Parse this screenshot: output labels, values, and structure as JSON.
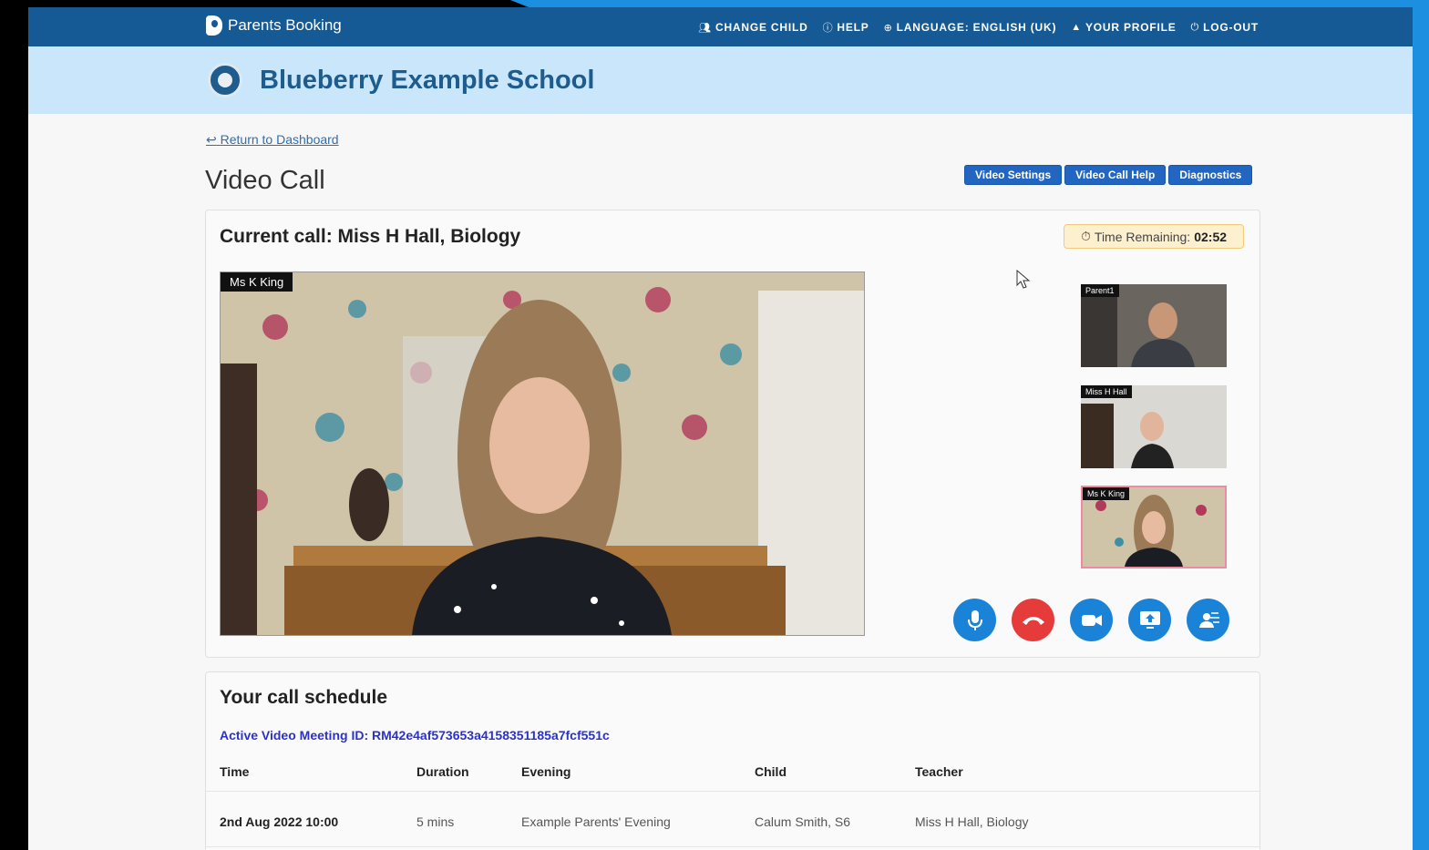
{
  "app": {
    "brand": "Parents Booking",
    "nav": [
      {
        "label": "CHANGE CHILD",
        "icon": "users-icon"
      },
      {
        "label": "HELP",
        "icon": "help-circle-icon"
      },
      {
        "label": "LANGUAGE: ENGLISH (UK)",
        "icon": "globe-icon"
      },
      {
        "label": "YOUR PROFILE",
        "icon": "user-icon"
      },
      {
        "label": "LOG-OUT",
        "icon": "power-icon"
      }
    ]
  },
  "school": {
    "name": "Blueberry Example School"
  },
  "page": {
    "return_link": "Return to Dashboard",
    "title": "Video Call",
    "buttons": {
      "video_settings": "Video Settings",
      "video_call_help": "Video Call Help",
      "diagnostics": "Diagnostics"
    }
  },
  "call": {
    "title": "Current call: Miss H Hall, Biology",
    "timer_label": "Time Remaining:",
    "timer_value": "02:52",
    "main_video_label": "Ms K King",
    "participants": [
      {
        "label": "Parent1"
      },
      {
        "label": "Miss H Hall"
      },
      {
        "label": "Ms K King"
      }
    ],
    "controls": [
      {
        "name": "microphone-button",
        "icon": "microphone-icon",
        "color": "#1a82d7"
      },
      {
        "name": "hang-up-button",
        "icon": "phone-hangup-icon",
        "color": "#e53b3b"
      },
      {
        "name": "camera-button",
        "icon": "video-camera-icon",
        "color": "#1a82d7"
      },
      {
        "name": "share-screen-button",
        "icon": "screen-share-icon",
        "color": "#1a82d7"
      },
      {
        "name": "background-blur-button",
        "icon": "background-blur-icon",
        "color": "#1a82d7"
      }
    ]
  },
  "schedule": {
    "title": "Your call schedule",
    "meeting_id": "Active Video Meeting ID: RM42e4af573653a4158351185a7fcf551c",
    "columns": [
      "Time",
      "Duration",
      "Evening",
      "Child",
      "Teacher"
    ],
    "rows": [
      {
        "time": "2nd Aug 2022 10:00",
        "duration": "5 mins",
        "evening": "Example Parents' Evening",
        "child": "Calum Smith, S6",
        "teacher": "Miss H Hall, Biology"
      }
    ]
  }
}
